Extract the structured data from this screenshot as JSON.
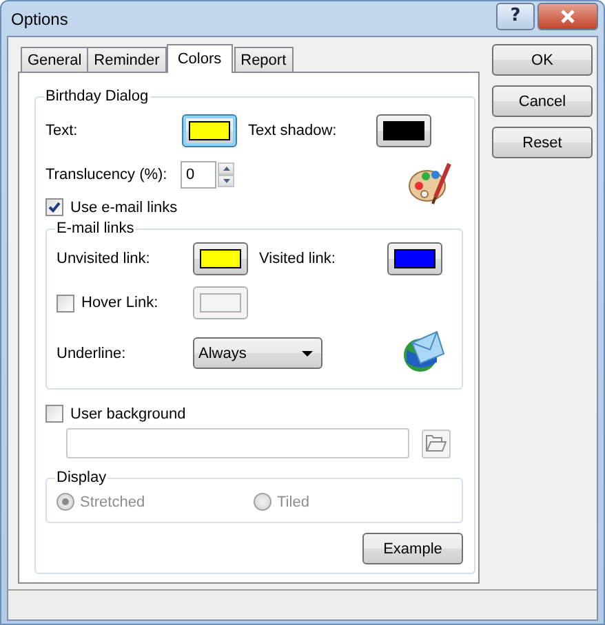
{
  "window": {
    "title": "Options",
    "help_button": "?"
  },
  "tabs": [
    {
      "label": "General",
      "selected": false
    },
    {
      "label": "Reminder",
      "selected": false
    },
    {
      "label": "Colors",
      "selected": true
    },
    {
      "label": "Report",
      "selected": false
    }
  ],
  "birthday_dialog": {
    "title": "Birthday Dialog",
    "text_color": {
      "label": "Text:",
      "color": "#ffff00",
      "focused": true
    },
    "text_shadow": {
      "label": "Text shadow:",
      "color": "#000000",
      "focused": false
    },
    "translucency": {
      "label": "Translucency (%):",
      "value": "0"
    },
    "use_email_links": {
      "label": "Use e-mail links",
      "checked": true
    }
  },
  "email_links": {
    "title": "E-mail links",
    "unvisited": {
      "label": "Unvisited link:",
      "color": "#ffff00",
      "focused": false
    },
    "visited": {
      "label": "Visited link:",
      "color": "#0000ff",
      "focused": false
    },
    "hover": {
      "label": "Hover Link:",
      "checked": false,
      "disabled": true
    },
    "underline": {
      "label": "Underline:",
      "value": "Always"
    }
  },
  "user_background": {
    "label": "User background",
    "checked": false,
    "disabled": true
  },
  "display": {
    "title": "Display",
    "options": [
      {
        "label": "Stretched",
        "selected": true,
        "disabled": true
      },
      {
        "label": "Tiled",
        "selected": false,
        "disabled": true
      }
    ]
  },
  "example_button": "Example",
  "buttons": [
    "OK",
    "Cancel",
    "Reset"
  ]
}
